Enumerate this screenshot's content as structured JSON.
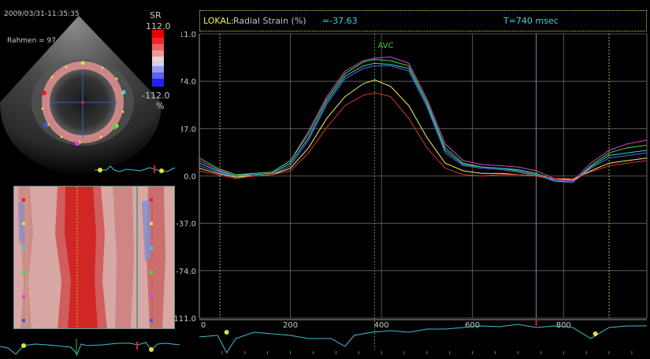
{
  "echo": {
    "timestamp": "2009/03/31-11:35:35",
    "frame_label": "Rahmen = 97",
    "scale_label": "SR",
    "scale_max": "112.0",
    "scale_min": "-112.0",
    "scale_unit": "%"
  },
  "header": {
    "mode": "LOKAL:",
    "metric": "Radial Strain (%)",
    "value": "=-37.63",
    "time": "T=740 msec"
  },
  "colors": {
    "background": "#000000",
    "grid": "#6a6a6a",
    "axis_text": "#c8c8c8",
    "ecg": "#40c0d0",
    "marker_avc": "#40c040",
    "marker_cursor": "#7090a0"
  },
  "chart_data": {
    "type": "line",
    "title": "",
    "xlabel": "",
    "ylabel": "Radial Strain (%)",
    "xlim": [
      0,
      983
    ],
    "ylim": [
      -111.0,
      111.0
    ],
    "x_ticks": [
      "0",
      "200",
      "400",
      "600",
      "800"
    ],
    "y_ticks": [
      "111.0",
      "74.0",
      "37.0",
      "0.0",
      "-37.0",
      "-74.0",
      "-111.0"
    ],
    "annotations": [
      {
        "label": "AVC",
        "x": 385
      }
    ],
    "cursor_x": 740,
    "x": [
      0,
      40,
      80,
      120,
      160,
      200,
      240,
      280,
      320,
      360,
      385,
      420,
      460,
      500,
      540,
      580,
      620,
      660,
      700,
      740,
      780,
      820,
      860,
      900,
      940,
      983
    ],
    "series": [
      {
        "color": "#e040e0",
        "values": [
          12,
          5,
          0,
          2,
          3,
          12,
          35,
          62,
          82,
          90,
          92,
          93,
          88,
          60,
          25,
          12,
          9,
          8,
          7,
          4,
          -2,
          -4,
          10,
          20,
          25,
          28
        ]
      },
      {
        "color": "#40e040",
        "values": [
          14,
          6,
          1,
          2,
          3,
          12,
          33,
          60,
          80,
          89,
          91,
          90,
          86,
          58,
          22,
          10,
          7,
          6,
          5,
          2,
          -3,
          -5,
          8,
          18,
          22,
          24
        ]
      },
      {
        "color": "#40d0d0",
        "values": [
          10,
          4,
          0,
          1,
          2,
          10,
          30,
          58,
          78,
          86,
          88,
          87,
          84,
          56,
          20,
          9,
          7,
          6,
          4,
          1,
          -4,
          -5,
          7,
          16,
          18,
          20
        ]
      },
      {
        "color": "#6060f0",
        "values": [
          8,
          3,
          -1,
          0,
          1,
          8,
          28,
          56,
          76,
          84,
          86,
          86,
          82,
          54,
          18,
          8,
          6,
          5,
          3,
          0,
          -3,
          -5,
          6,
          14,
          16,
          18
        ]
      },
      {
        "color": "#f0f060",
        "values": [
          6,
          2,
          -1,
          0,
          1,
          6,
          22,
          45,
          62,
          72,
          75,
          70,
          55,
          30,
          10,
          4,
          2,
          2,
          1,
          0,
          -2,
          -3,
          4,
          10,
          12,
          14
        ]
      },
      {
        "color": "#e03030",
        "values": [
          4,
          1,
          -2,
          0,
          1,
          4,
          18,
          38,
          55,
          63,
          65,
          62,
          45,
          22,
          6,
          1,
          0,
          1,
          1,
          0,
          -2,
          -2,
          3,
          8,
          10,
          12
        ]
      }
    ]
  }
}
